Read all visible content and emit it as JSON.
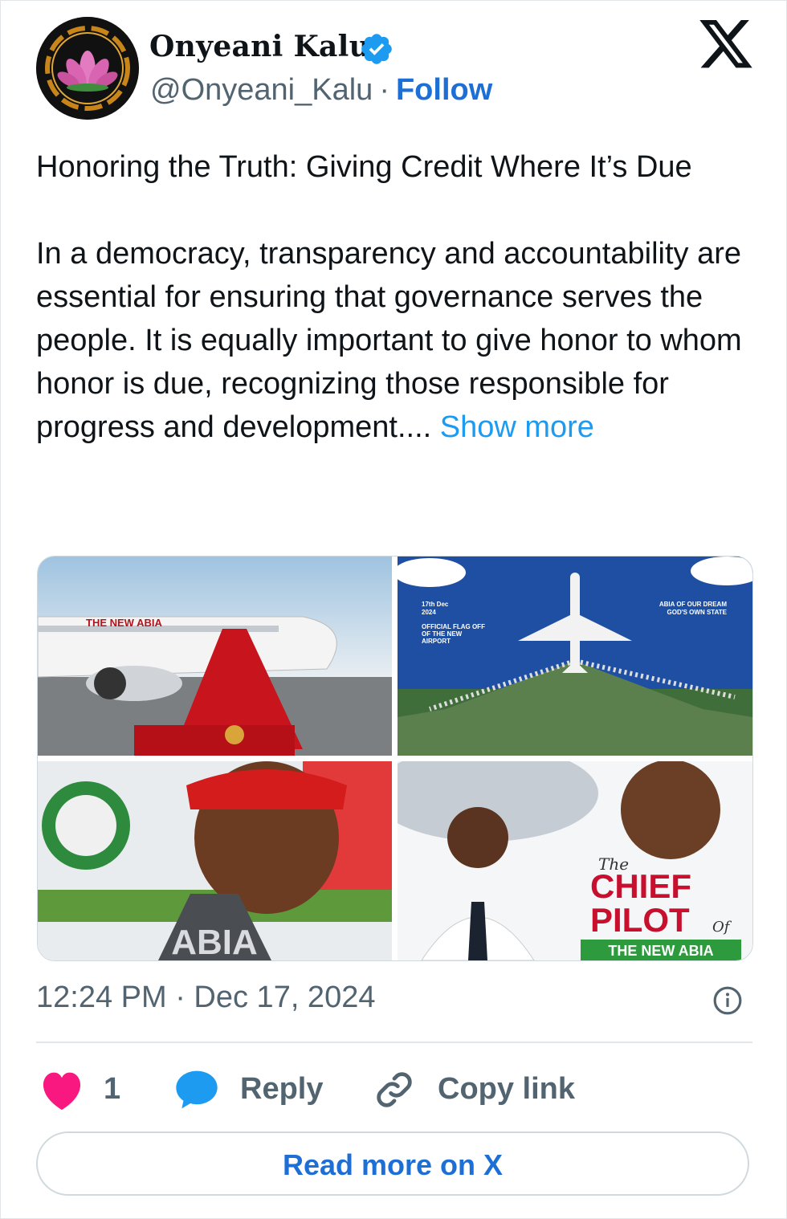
{
  "author": {
    "name": "Onyeani Kalu",
    "handle": "@Onyeani_Kalu",
    "separator": "·",
    "follow_label": "Follow",
    "verified_icon": "verified-badge-icon",
    "avatar_icon": "lotus-flower-icon"
  },
  "post": {
    "title_line": "Honoring the Truth: Giving Credit Where It’s Due",
    "body": "In a democracy, transparency and accountability are essential for ensuring that governance serves the people. It is equally important to give honor to whom honor is due, recognizing those responsible for progress and development....",
    "show_more": "Show more"
  },
  "media": {
    "tile1_banner": "THE NEW ABIA",
    "tile2_left": [
      "17th Dec",
      "2024",
      "OFFICIAL FLAG OFF",
      "OF THE NEW",
      "AIRPORT"
    ],
    "tile2_right": [
      "ABIA OF OUR DREAM",
      "GOD'S OWN STATE"
    ],
    "tile3_road": "ABIA",
    "tile4_the": "The",
    "tile4_chief": "CHIEF",
    "tile4_pilot": "PILOT",
    "tile4_of": "Of",
    "tile4_banner": "THE NEW ABIA"
  },
  "meta": {
    "timestamp": "12:24 PM · Dec 17, 2024"
  },
  "actions": {
    "like_count": "1",
    "reply_label": "Reply",
    "copy_label": "Copy link",
    "read_more": "Read more on X"
  },
  "colors": {
    "link_blue": "#1d9bf0",
    "follow_blue": "#1d6fd6",
    "heart_pink": "#f91880",
    "muted": "#536471"
  }
}
